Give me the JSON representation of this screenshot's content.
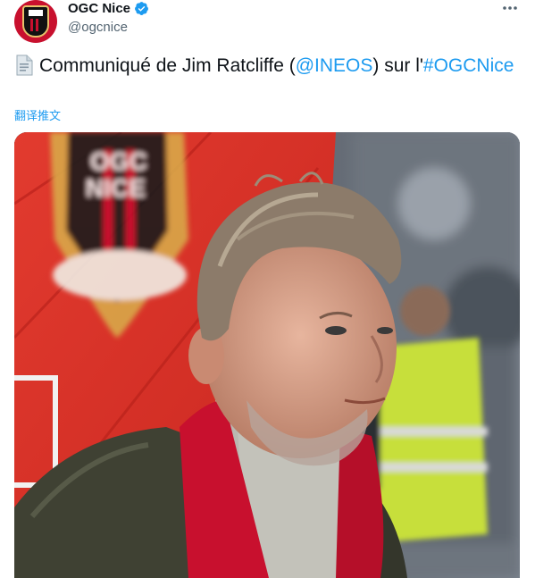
{
  "account": {
    "display_name": "OGC Nice",
    "handle": "@ogcnice",
    "avatar": "ogc-nice-crest-avatar",
    "verified_icon": "verified-badge-icon"
  },
  "menu": {
    "more_icon": "more-options-icon"
  },
  "tweet": {
    "doc_icon": "document-emoji-icon",
    "text_pre": "Communiqué de Jim Ratcliffe (",
    "mention": "@INEOS",
    "text_mid": ") sur l'",
    "hashtag": "#OGCNice",
    "translate_label": "翻译推文"
  },
  "media": {
    "crest_text_line1": "OGC",
    "crest_text_line2": "NICE",
    "image_alt": "Photo of Jim Ratcliffe wearing a red scarf in front of the OGC Nice crest at a stadium"
  },
  "colors": {
    "accent": "#1d9bf0",
    "text": "#0f1419",
    "muted": "#536471",
    "brand_red": "#c8102e"
  }
}
